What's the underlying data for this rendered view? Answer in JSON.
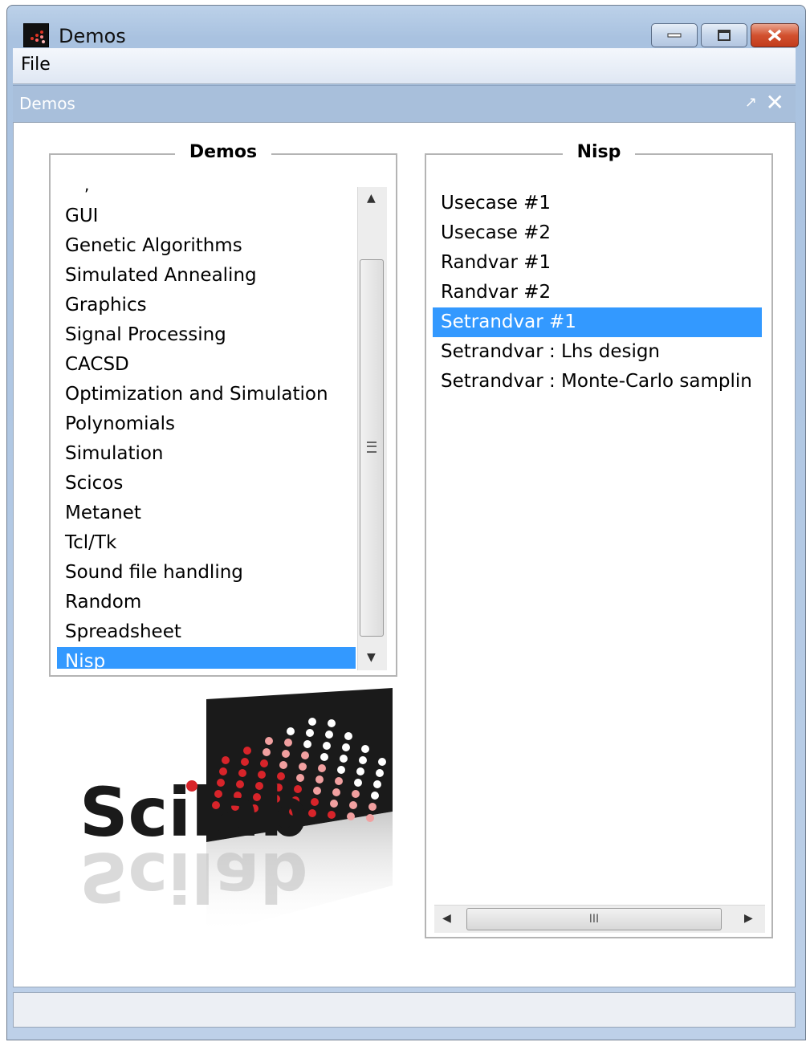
{
  "window": {
    "title": "Demos"
  },
  "menubar": {
    "file_label": "File"
  },
  "dock": {
    "title": "Demos",
    "undock_glyph": "↗",
    "close_glyph": "✕"
  },
  "demos_panel": {
    "title": "Demos",
    "items": [
      {
        "label": "GUI"
      },
      {
        "label": "Genetic Algorithms"
      },
      {
        "label": "Simulated Annealing"
      },
      {
        "label": "Graphics"
      },
      {
        "label": "Signal Processing"
      },
      {
        "label": "CACSD"
      },
      {
        "label": "Optimization and Simulation"
      },
      {
        "label": "Polynomials"
      },
      {
        "label": "Simulation"
      },
      {
        "label": "Scicos"
      },
      {
        "label": "Metanet"
      },
      {
        "label": "Tcl/Tk"
      },
      {
        "label": "Sound file handling"
      },
      {
        "label": "Random"
      },
      {
        "label": "Spreadsheet"
      },
      {
        "label": "Nisp"
      }
    ],
    "selected_index": 15
  },
  "nisp_panel": {
    "title": "Nisp",
    "items": [
      {
        "label": "Usecase #1"
      },
      {
        "label": "Usecase #2"
      },
      {
        "label": "Randvar #1"
      },
      {
        "label": "Randvar #2"
      },
      {
        "label": "Setrandvar #1"
      },
      {
        "label": "Setrandvar : Lhs design"
      },
      {
        "label": "Setrandvar : Monte-Carlo samplin"
      }
    ],
    "selected_index": 4,
    "hscroll_grip": "III"
  },
  "logo": {
    "text": "Scilab"
  },
  "colors": {
    "selection": "#3399ff",
    "logo_dark": "#1a1a1a",
    "logo_red": "#d8242a"
  }
}
